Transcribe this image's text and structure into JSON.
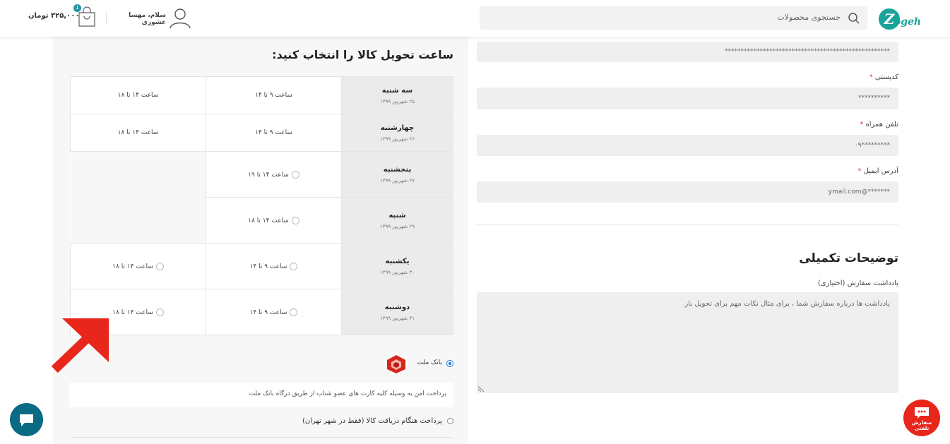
{
  "header": {
    "logo_text": "Zogeh",
    "search_placeholder": "جستجوی محصولات",
    "user_greeting": "سلام، مهسا عشوری",
    "cart_count": "1",
    "cart_total": "۳۲۵,۰۰۰ تومان"
  },
  "delivery": {
    "title": "ساعت تحویل کالا را انتخاب کنید:",
    "days": [
      {
        "name": "سه شنبه",
        "date": "۲۵ شهریور ۱۳۹۹",
        "slot1": "ساعت ۹ تا ۱۴",
        "slot2": "ساعت ۱۴ تا ۱۸"
      },
      {
        "name": "چهارشنبه",
        "date": "۲۶ شهریور ۱۳۹۹",
        "slot1": "ساعت ۹ تا ۱۴",
        "slot2": "ساعت ۱۴ تا ۱۸"
      },
      {
        "name": "پنجشنبه",
        "date": "۲۷ شهریور ۱۳۹۹",
        "slot1": "ساعت ۱۴ تا ۱۹"
      },
      {
        "name": "شنبه",
        "date": "۲۹ شهریور ۱۳۹۹",
        "slot1": "ساعت ۱۴ تا ۱۸"
      },
      {
        "name": "یکشنبه",
        "date": "۳۰ شهریور ۱۳۹۹",
        "slot1": "ساعت ۹ تا ۱۴",
        "slot2": "ساعت ۱۴ تا ۱۸"
      },
      {
        "name": "دوشنبه",
        "date": "۳۱ شهریور ۱۳۹۹",
        "slot1": "ساعت ۹ تا ۱۴",
        "slot2": "ساعت ۱۴ تا ۱۸"
      }
    ]
  },
  "payment": {
    "gateway_label": "بانک ملت",
    "gateway_description": "پرداخت امن به وسیله کلیه کارت های عضو شتاب از طریق درگاه بانک ملت",
    "cod_label": "پرداخت هنگام دریافت کالا (فقط در شهر تهران)"
  },
  "form": {
    "address_value": "****************************************************",
    "postal_label": "کدپستی",
    "postal_value": "**********",
    "mobile_label": "تلفن همراه",
    "mobile_value": "*********۰۹",
    "email_label": "آدرس ایمیل",
    "email_value": "*******@ymail.com",
    "required_mark": "*"
  },
  "notes": {
    "title": "توضیحات تکمیلی",
    "label": "یادداشت سفارش (اختیاری)",
    "placeholder": "یادداشت ها درباره سفارش شما ، برای مثال نکات مهم برای تحویل بار"
  },
  "floating": {
    "order_line1": "سفارش",
    "order_line2": "تلفنی"
  },
  "colors": {
    "accent": "#1aa39a",
    "arrow": "#e8261b",
    "chat": "#0b6a84"
  }
}
